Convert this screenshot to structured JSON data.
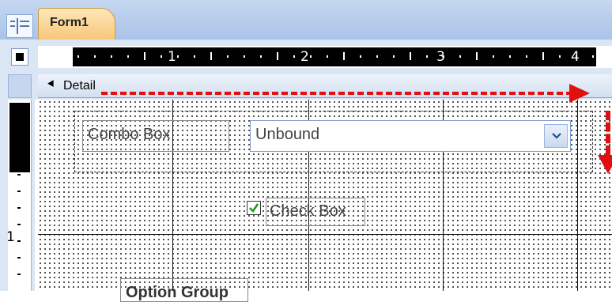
{
  "document_tab": {
    "label": "Form1",
    "icon": "form-icon"
  },
  "ruler": {
    "numbers": [
      "1",
      "2",
      "3",
      "4"
    ],
    "vertical_number": "1"
  },
  "section": {
    "label": "Detail",
    "icon": "collapse-arrow-icon"
  },
  "controls": {
    "combo_box_label": "Combo Box",
    "combo_box_value": "Unbound",
    "combo_dropdown_icon": "chevron-down-icon",
    "check_box_label": "Check Box",
    "check_box_checked": true,
    "option_group_label": "Option Group"
  },
  "colors": {
    "resize_arrow": "#e01010",
    "tab": "#f7c77a",
    "chrome": "#dbe6f5"
  }
}
